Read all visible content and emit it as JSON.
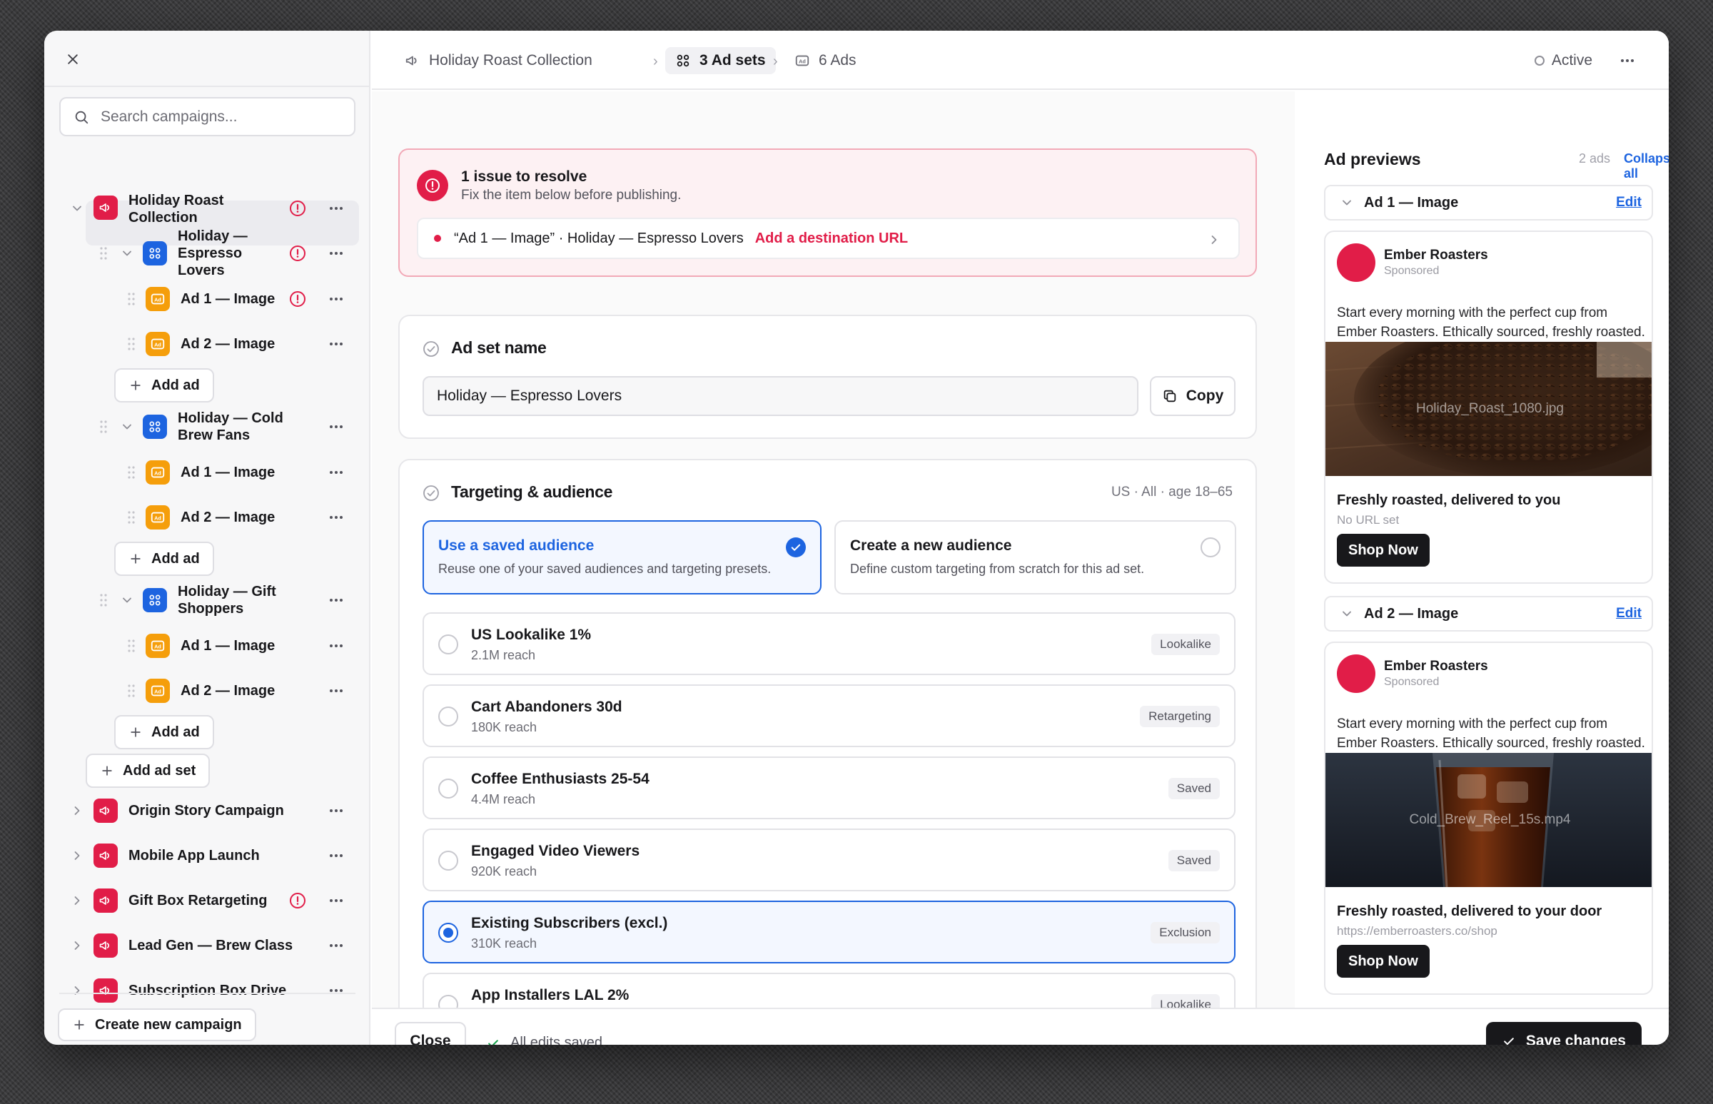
{
  "sidebar": {
    "search_placeholder": "Search campaigns...",
    "campaigns": [
      {
        "label_lines": [
          "Holiday Roast",
          "Collection"
        ],
        "warning": true,
        "adsets": [
          {
            "label_lines": [
              "Holiday —",
              "Espresso",
              "Lovers"
            ],
            "warning": true,
            "ads": [
              {
                "label": "Ad 1 — Image",
                "warning": true
              },
              {
                "label": "Ad 2 — Image",
                "warning": false
              }
            ],
            "add_ad_label": "Add ad"
          },
          {
            "label_lines": [
              "Holiday — Cold",
              "Brew Fans"
            ],
            "warning": false,
            "ads": [
              {
                "label": "Ad 1 — Image",
                "warning": false
              },
              {
                "label": "Ad 2 — Image",
                "warning": false
              }
            ],
            "add_ad_label": "Add ad"
          },
          {
            "label_lines": [
              "Holiday — Gift",
              "Shoppers"
            ],
            "warning": false,
            "ads": [
              {
                "label": "Ad 1 — Image",
                "warning": false
              },
              {
                "label": "Ad 2 — Image",
                "warning": false
              }
            ],
            "add_ad_label": "Add ad"
          }
        ],
        "add_adset_label": "Add ad set"
      },
      {
        "label": "Origin Story Campaign",
        "warning": false
      },
      {
        "label": "Mobile App Launch",
        "warning": false
      },
      {
        "label": "Gift Box Retargeting",
        "warning": true
      },
      {
        "label": "Lead Gen — Brew Class",
        "warning": false
      },
      {
        "label": "Subscription Box Drive",
        "warning": false
      }
    ],
    "create_label": "Create new campaign"
  },
  "topbar": {
    "crumbs": [
      {
        "label": "Holiday Roast Collection",
        "icon": "megaphone-icon"
      },
      {
        "label": "3 Ad sets",
        "icon": "adset-grid-icon"
      },
      {
        "label": "6 Ads",
        "icon": "ad-icon"
      }
    ],
    "status": "Active"
  },
  "issue": {
    "title": "1 issue to resolve",
    "subtitle": "Fix the item below before publishing.",
    "item_text": "“Ad 1 — Image” · Holiday — Espresso Lovers",
    "item_fix": "Add a destination URL"
  },
  "adset_name": {
    "title": "Ad set name",
    "value": "Holiday — Espresso Lovers",
    "copy_label": "Copy"
  },
  "targeting": {
    "title": "Targeting & audience",
    "meta": "US · All · age 18–65",
    "choices": [
      {
        "title": "Use a saved audience",
        "desc": "Reuse one of your saved audiences and targeting presets.",
        "selected": true
      },
      {
        "title": "Create a new audience",
        "desc": "Define custom targeting from scratch for this ad set.",
        "selected": false
      }
    ],
    "audiences": [
      {
        "name": "US Lookalike 1%",
        "reach": "2.1M reach",
        "tag": "Lookalike",
        "selected": false
      },
      {
        "name": "Cart Abandoners 30d",
        "reach": "180K reach",
        "tag": "Retargeting",
        "selected": false
      },
      {
        "name": "Coffee Enthusiasts 25-54",
        "reach": "4.4M reach",
        "tag": "Saved",
        "selected": false
      },
      {
        "name": "Engaged Video Viewers",
        "reach": "920K reach",
        "tag": "Saved",
        "selected": false
      },
      {
        "name": "Existing Subscribers (excl.)",
        "reach": "310K reach",
        "tag": "Exclusion",
        "selected": true
      },
      {
        "name": "App Installers LAL 2%",
        "reach": "",
        "tag": "Lookalike",
        "selected": false
      }
    ]
  },
  "previews": {
    "title": "Ad previews",
    "count": "2 ads",
    "collapse_label": "Collapse all",
    "ads": [
      {
        "label": "Ad 1 — Image",
        "edit_label": "Edit",
        "brand": "Ember Roasters",
        "sponsored": "Sponsored",
        "copy": "Start every morning with the perfect cup from Ember Roasters. Ethically sourced, freshly roasted.",
        "media": "Holiday_Roast_1080.jpg",
        "headline": "Freshly roasted, delivered to you",
        "url": "No URL set",
        "cta": "Shop Now"
      },
      {
        "label": "Ad 2 — Image",
        "edit_label": "Edit",
        "brand": "Ember Roasters",
        "sponsored": "Sponsored",
        "copy": "Start every morning with the perfect cup from Ember Roasters. Ethically sourced, freshly roasted.",
        "media": "Cold_Brew_Reel_15s.mp4",
        "headline": "Freshly roasted, delivered to your door",
        "url": "https://emberroasters.co/shop",
        "cta": "Shop Now"
      }
    ]
  },
  "footer": {
    "close_label": "Close",
    "saved_label": "All edits saved",
    "save_label": "Save changes"
  },
  "colors": {
    "brand_red": "#e11d48",
    "accent_blue": "#1d64e0",
    "ad_orange": "#f59e0b"
  }
}
